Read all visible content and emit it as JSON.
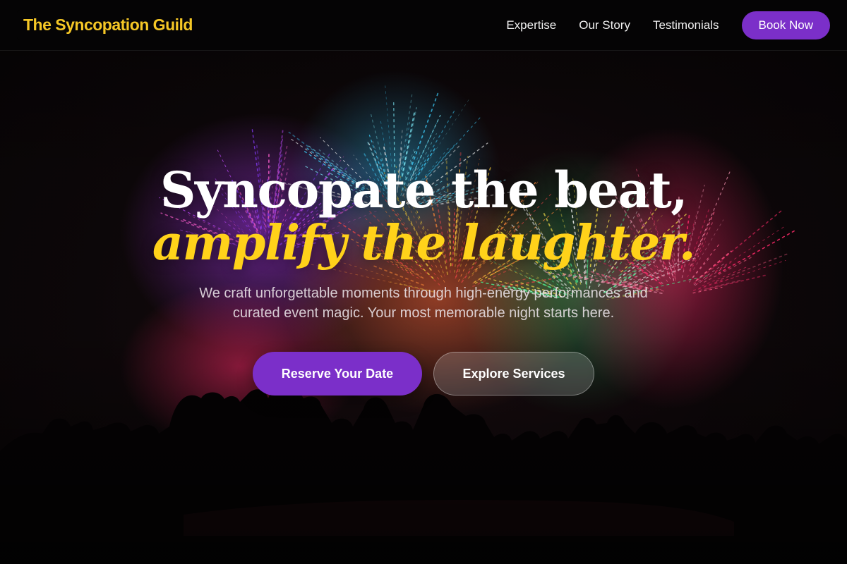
{
  "nav": {
    "brand": "The Syncopation Guild",
    "links": [
      "Expertise",
      "Our Story",
      "Testimonials"
    ],
    "cta": "Book Now"
  },
  "hero": {
    "headline_line1": "Syncopate the beat,",
    "headline_line2": "amplify the laughter.",
    "subtitle": "We craft unforgettable moments through high-energy performances and curated event magic. Your most memorable night starts here.",
    "primary_cta": "Reserve Your Date",
    "secondary_cta": "Explore Services"
  },
  "colors": {
    "brand": "#f5c726",
    "accent": "#7b2fc9",
    "headline_highlight": "#ffd21a",
    "background": "#0b0708"
  }
}
